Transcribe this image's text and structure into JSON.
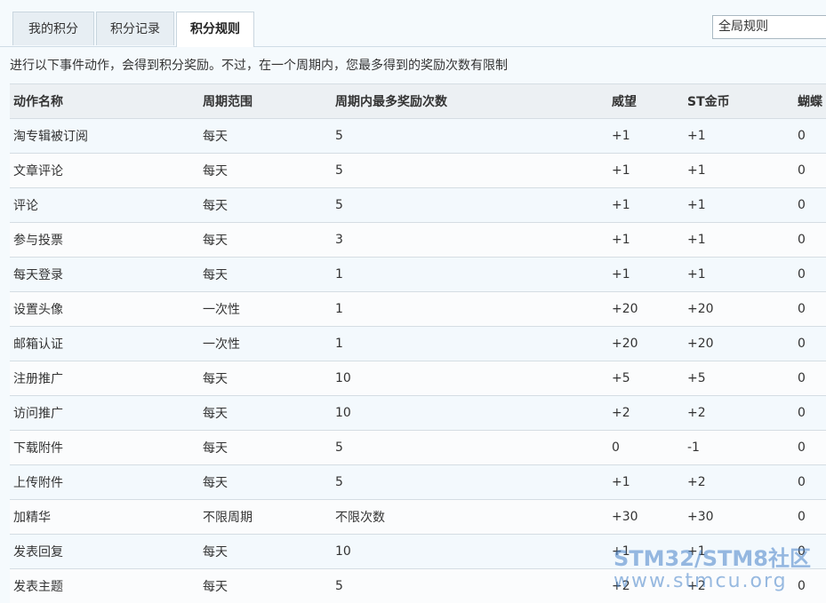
{
  "tabs": [
    {
      "label": "我的积分",
      "active": false
    },
    {
      "label": "积分记录",
      "active": false
    },
    {
      "label": "积分规则",
      "active": true
    }
  ],
  "scope_select": {
    "value": "全局规则"
  },
  "description": "进行以下事件动作，会得到积分奖励。不过，在一个周期内，您最多得到的奖励次数有限制",
  "table": {
    "headers": [
      "动作名称",
      "周期范围",
      "周期内最多奖励次数",
      "威望",
      "ST金币",
      "蝴蝶"
    ],
    "rows": [
      [
        "淘专辑被订阅",
        "每天",
        "5",
        "+1",
        "+1",
        "0"
      ],
      [
        "文章评论",
        "每天",
        "5",
        "+1",
        "+1",
        "0"
      ],
      [
        "评论",
        "每天",
        "5",
        "+1",
        "+1",
        "0"
      ],
      [
        "参与投票",
        "每天",
        "3",
        "+1",
        "+1",
        "0"
      ],
      [
        "每天登录",
        "每天",
        "1",
        "+1",
        "+1",
        "0"
      ],
      [
        "设置头像",
        "一次性",
        "1",
        "+20",
        "+20",
        "0"
      ],
      [
        "邮箱认证",
        "一次性",
        "1",
        "+20",
        "+20",
        "0"
      ],
      [
        "注册推广",
        "每天",
        "10",
        "+5",
        "+5",
        "0"
      ],
      [
        "访问推广",
        "每天",
        "10",
        "+2",
        "+2",
        "0"
      ],
      [
        "下载附件",
        "每天",
        "5",
        "0",
        "-1",
        "0"
      ],
      [
        "上传附件",
        "每天",
        "5",
        "+1",
        "+2",
        "0"
      ],
      [
        "加精华",
        "不限周期",
        "不限次数",
        "+30",
        "+30",
        "0"
      ],
      [
        "发表回复",
        "每天",
        "10",
        "+1",
        "+1",
        "0"
      ],
      [
        "发表主题",
        "每天",
        "5",
        "+2",
        "+2",
        "0"
      ]
    ]
  },
  "watermark": {
    "line1": "STM32/STM8社区",
    "line2": "www.stmcu.org"
  }
}
